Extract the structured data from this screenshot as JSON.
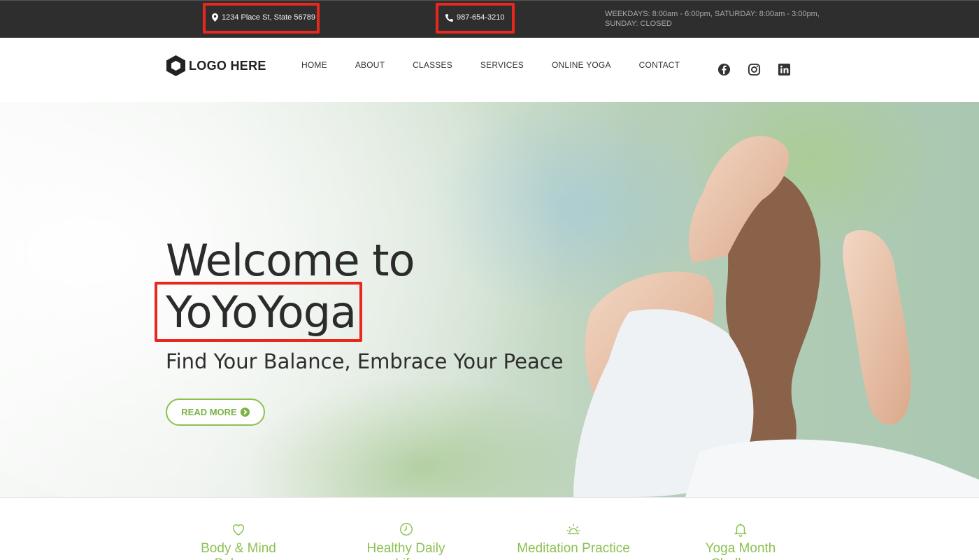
{
  "topbar": {
    "address": "1234 Place St, State 56789",
    "phone": "987-654-3210",
    "hours_line1": "WEEKDAYS: 8:00am - 6:00pm, SATURDAY: 8:00am - 3:00pm,",
    "hours_line2": "SUNDAY: CLOSED"
  },
  "header": {
    "logo_text": "LOGO HERE",
    "nav": [
      "HOME",
      "ABOUT",
      "CLASSES",
      "SERVICES",
      "ONLINE YOGA",
      "CONTACT"
    ],
    "social": [
      "facebook-icon",
      "instagram-icon",
      "linkedin-icon"
    ]
  },
  "hero": {
    "title_line1": "Welcome to",
    "title_line2": "YoYoYoga",
    "subtitle": "Find Your Balance, Embrace Your Peace",
    "button": "READ MORE"
  },
  "features": [
    {
      "icon": "heart-icon",
      "label": "Body & Mind Balance"
    },
    {
      "icon": "clock-icon",
      "label": "Healthy Daily Life"
    },
    {
      "icon": "sunrise-icon",
      "label": "Meditation Practice"
    },
    {
      "icon": "bell-icon",
      "label": "Yoga Month Challenge"
    }
  ],
  "colors": {
    "accent": "#8cc152",
    "topbar": "#2e2e2e",
    "highlight": "#e8281d"
  }
}
